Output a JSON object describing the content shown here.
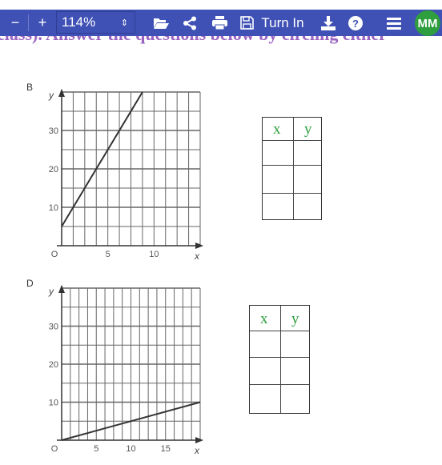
{
  "document": {
    "partial_text": "class). Answer the questions below by circling either"
  },
  "toolbar": {
    "zoom_out_icon": "minus-icon",
    "zoom_in_icon": "plus-icon",
    "zoom_minus": "−",
    "zoom_plus": "+",
    "zoom_value": "114%",
    "zoom_arrows": "⇕",
    "open": "folder-open-icon",
    "share": "share-icon",
    "print": "print-icon",
    "save": "save-icon",
    "turn_in": "Turn In",
    "download": "download-icon",
    "help": "help-icon",
    "menu": "menu-icon",
    "avatar": "MM",
    "color": "#3f51b5",
    "avatar_color": "#2e9e3e"
  },
  "graphs": [
    {
      "label": "B",
      "table_headers": [
        "x",
        "y"
      ]
    },
    {
      "label": "D",
      "table_headers": [
        "x",
        "y"
      ]
    }
  ],
  "chart_data": [
    {
      "type": "line",
      "title": "B",
      "xlabel": "x",
      "ylabel": "y",
      "xlim": [
        0,
        15
      ],
      "ylim": [
        0,
        40
      ],
      "x_ticks": [
        "5",
        "10"
      ],
      "y_ticks": [
        "10",
        "20",
        "30"
      ],
      "origin_label": "O",
      "grid": true,
      "x_grid_step": 1.25,
      "y_grid_step": 5,
      "points": [
        [
          0,
          5
        ],
        [
          8.75,
          40
        ]
      ]
    },
    {
      "type": "line",
      "title": "D",
      "xlabel": "x",
      "ylabel": "y",
      "xlim": [
        0,
        20
      ],
      "ylim": [
        0,
        40
      ],
      "x_ticks": [
        "5",
        "10",
        "15"
      ],
      "y_ticks": [
        "10",
        "20",
        "30"
      ],
      "origin_label": "O",
      "grid": true,
      "x_grid_step": 1.25,
      "y_grid_step": 5,
      "points": [
        [
          0,
          0
        ],
        [
          20,
          10
        ]
      ]
    }
  ]
}
